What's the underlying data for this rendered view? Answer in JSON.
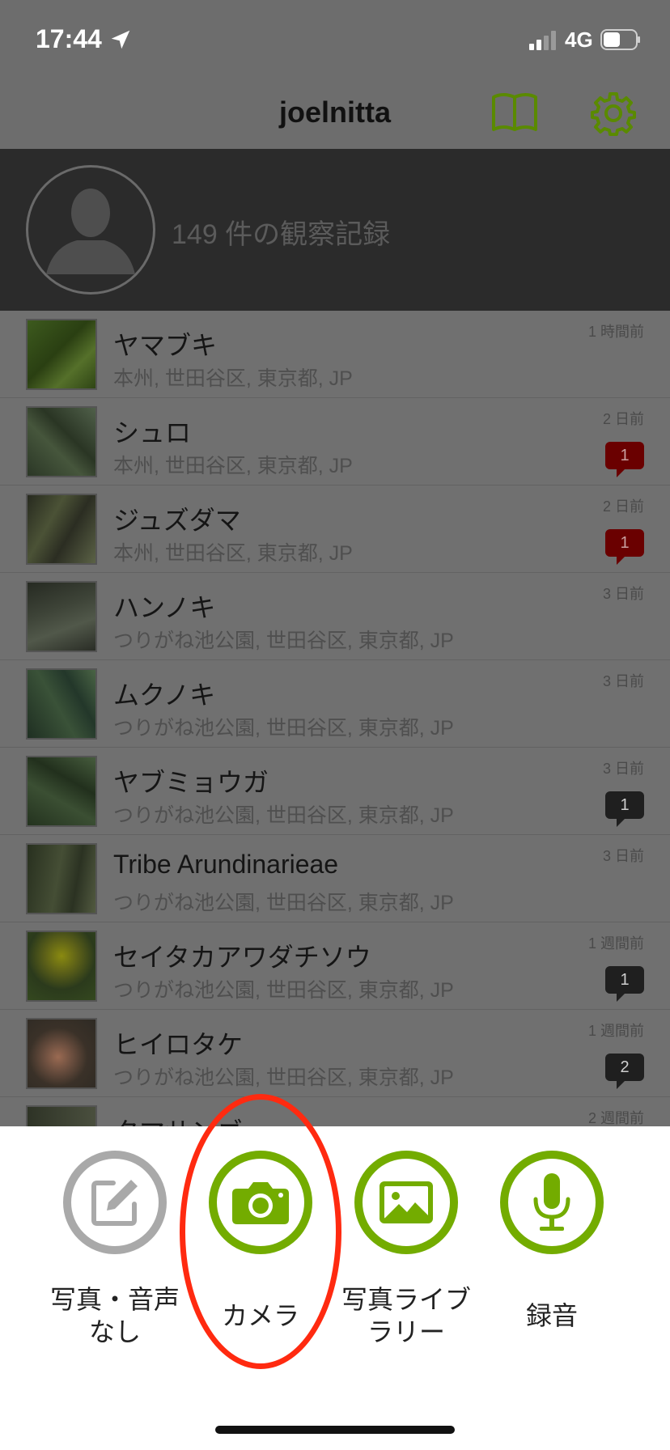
{
  "status_bar": {
    "time": "17:44",
    "network": "4G",
    "icons": [
      "location-arrow-icon",
      "signal-icon",
      "battery-icon"
    ]
  },
  "navbar": {
    "title": "joelnitta",
    "icons": [
      "book-icon",
      "gear-icon"
    ],
    "accent": "#73ac00"
  },
  "profile": {
    "observation_count": "149 件の観察記録",
    "avatar_icon": "person-silhouette-icon"
  },
  "observations": [
    {
      "name": "ヤマブキ",
      "location": "本州, 世田谷区, 東京都, JP",
      "time": "1 時間前",
      "comments": "",
      "badge": "none"
    },
    {
      "name": "シュロ",
      "location": "本州, 世田谷区, 東京都, JP",
      "time": "2 日前",
      "comments": "1",
      "badge": "red"
    },
    {
      "name": "ジュズダマ",
      "location": "本州, 世田谷区, 東京都, JP",
      "time": "2 日前",
      "comments": "1",
      "badge": "red"
    },
    {
      "name": "ハンノキ",
      "location": "つりがね池公園, 世田谷区, 東京都, JP",
      "time": "3 日前",
      "comments": "",
      "badge": "none"
    },
    {
      "name": "ムクノキ",
      "location": "つりがね池公園, 世田谷区, 東京都, JP",
      "time": "3 日前",
      "comments": "",
      "badge": "none"
    },
    {
      "name": "ヤブミョウガ",
      "location": "つりがね池公園, 世田谷区, 東京都, JP",
      "time": "3 日前",
      "comments": "1",
      "badge": "dark"
    },
    {
      "name": "Tribe Arundinarieae",
      "location": "つりがね池公園, 世田谷区, 東京都, JP",
      "time": "3 日前",
      "comments": "",
      "badge": "none"
    },
    {
      "name": "セイタカアワダチソウ",
      "location": "つりがね池公園, 世田谷区, 東京都, JP",
      "time": "1 週間前",
      "comments": "1",
      "badge": "dark"
    },
    {
      "name": "ヒイロタケ",
      "location": "つりがね池公園, 世田谷区, 東京都, JP",
      "time": "1 週間前",
      "comments": "2",
      "badge": "dark"
    },
    {
      "name": "タマサンゴ",
      "location": "",
      "time": "2 週間前",
      "comments": "",
      "badge": "none"
    }
  ],
  "actions": {
    "no_media": {
      "label": "写真・音声\nなし",
      "icon": "edit-note-icon"
    },
    "camera": {
      "label": "カメラ",
      "icon": "camera-icon"
    },
    "library": {
      "label": "写真ライブ\nラリー",
      "icon": "image-icon"
    },
    "record": {
      "label": "録音",
      "icon": "microphone-icon"
    }
  },
  "colors": {
    "accent_green": "#73ac00",
    "highlight_red": "#ff2a10"
  }
}
